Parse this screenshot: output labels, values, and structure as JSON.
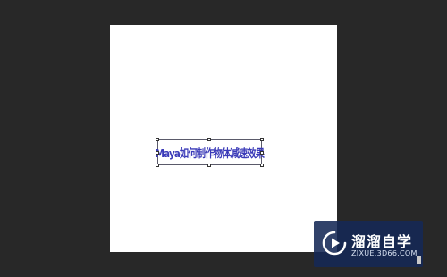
{
  "canvas": {
    "background": "#ffffff",
    "text_layer": {
      "text": "Maya如何制作物体减速效果",
      "color": "#3a3ab8"
    }
  },
  "workspace": {
    "background": "#282828"
  },
  "watermark": {
    "title": "溜溜自学",
    "url": "ZIXUE.3D66.COM",
    "logo_icon": "play-icon",
    "background": "#142855"
  }
}
